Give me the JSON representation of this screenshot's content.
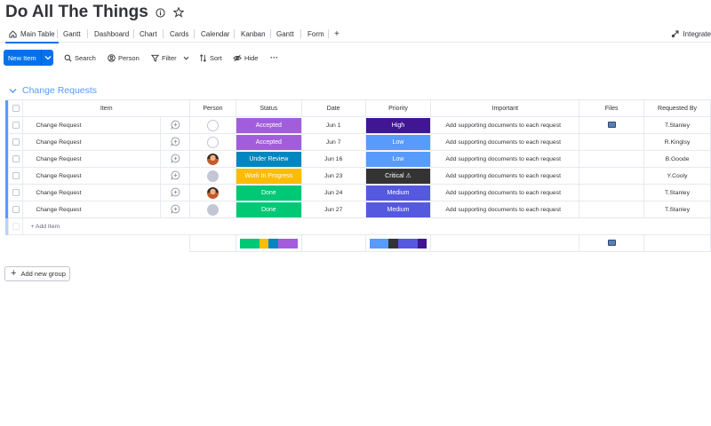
{
  "board": {
    "title": "Do All The Things"
  },
  "tabs": [
    {
      "label": "Main Table",
      "active": true
    },
    {
      "label": "Gantt"
    },
    {
      "label": "Dashboard"
    },
    {
      "label": "Chart"
    },
    {
      "label": "Cards"
    },
    {
      "label": "Calendar"
    },
    {
      "label": "Kanban"
    },
    {
      "label": "Gantt"
    },
    {
      "label": "Form"
    },
    {
      "label": "+"
    }
  ],
  "integrate_label": "Integrate",
  "toolbar": {
    "new_item_label": "New Item",
    "search_label": "Search",
    "person_label": "Person",
    "filter_label": "Filter",
    "sort_label": "Sort",
    "hide_label": "Hide",
    "more_label": "···"
  },
  "group": {
    "title": "Change Requests",
    "color": "#579bfc",
    "columns": [
      "Item",
      "Person",
      "Status",
      "Date",
      "Priority",
      "Important",
      "Files",
      "Requested By"
    ],
    "rows": [
      {
        "item": "Change Request",
        "person": "empty",
        "status": "Accepted",
        "status_color": "#a25ddc",
        "date": "Jun 1",
        "priority": "High",
        "priority_color": "#401694",
        "important": "Add supporting documents to each request",
        "file": true,
        "requested_by": "T.Stanley"
      },
      {
        "item": "Change Request",
        "person": "empty",
        "status": "Accepted",
        "status_color": "#a25ddc",
        "date": "Jun 7",
        "priority": "Low",
        "priority_color": "#579bfc",
        "important": "Add supporting documents to each request",
        "file": false,
        "requested_by": "R.Kinglsy"
      },
      {
        "item": "Change Request",
        "person": "photo",
        "status": "Under Review",
        "status_color": "#0086c0",
        "date": "Jun 16",
        "priority": "Low",
        "priority_color": "#579bfc",
        "important": "Add supporting documents to each request",
        "file": false,
        "requested_by": "B.Goode"
      },
      {
        "item": "Change Request",
        "person": "gray",
        "status": "Work In Progress",
        "status_color": "#fdbc00",
        "date": "Jun 23",
        "priority": "Critical ⚠",
        "priority_color": "#333333",
        "important": "Add supporting documents to each request",
        "file": false,
        "requested_by": "Y.Cooly"
      },
      {
        "item": "Change Request",
        "person": "photo",
        "status": "Done",
        "status_color": "#00c875",
        "date": "Jun 24",
        "priority": "Medium",
        "priority_color": "#5559df",
        "important": "Add supporting documents to each request",
        "file": false,
        "requested_by": "T.Stanley"
      },
      {
        "item": "Change Request",
        "person": "gray",
        "status": "Done",
        "status_color": "#00c875",
        "date": "Jun 27",
        "priority": "Medium",
        "priority_color": "#5559df",
        "important": "Add supporting documents to each request",
        "file": false,
        "requested_by": "T.Stanley"
      }
    ],
    "add_item_label": "+ Add Item",
    "status_summary": [
      {
        "color": "#00c875",
        "fraction": 0.3333
      },
      {
        "color": "#fdbc00",
        "fraction": 0.1667
      },
      {
        "color": "#0086c0",
        "fraction": 0.1667
      },
      {
        "color": "#a25ddc",
        "fraction": 0.3333
      }
    ],
    "priority_summary": [
      {
        "color": "#579bfc",
        "fraction": 0.3333
      },
      {
        "color": "#333333",
        "fraction": 0.1667
      },
      {
        "color": "#5559df",
        "fraction": 0.3333
      },
      {
        "color": "#401694",
        "fraction": 0.1667
      }
    ]
  },
  "add_group_label": "Add new group"
}
